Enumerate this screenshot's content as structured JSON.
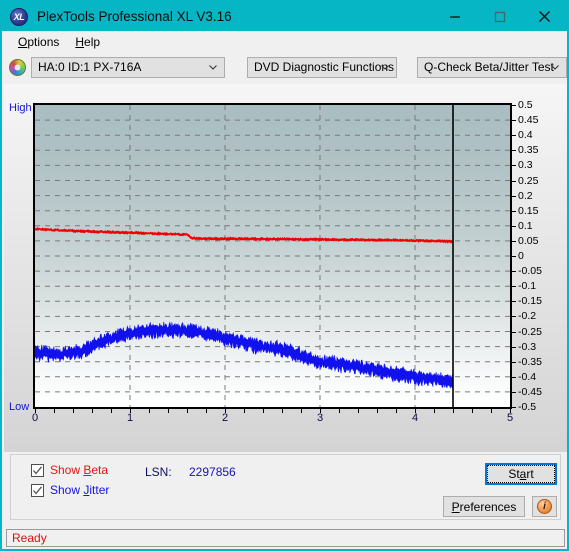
{
  "window": {
    "title": "PlexTools Professional XL V3.16",
    "icon": "xl-logo-icon",
    "minimize_label": "minimize-icon",
    "maximize_label": "maximize-icon",
    "close_label": "close-icon",
    "titlebar_color": "#06b6c4"
  },
  "menu": {
    "items": [
      {
        "label": "Options",
        "accel": "O"
      },
      {
        "label": "Help",
        "accel": "H"
      }
    ]
  },
  "toolbar": {
    "drive_icon": "optical-disc-icon",
    "drive_select": "HA:0 ID:1  PX-716A",
    "function_select": "DVD Diagnostic Functions",
    "test_select": "Q-Check Beta/Jitter Test"
  },
  "chart_labels": {
    "high": "High",
    "low": "Low"
  },
  "controls": {
    "show_beta": {
      "label_pre": "Show ",
      "accel": "B",
      "label_post": "eta",
      "checked": true,
      "color": "#e81414"
    },
    "show_jitter": {
      "label_pre": "Show ",
      "accel": "J",
      "label_post": "itter",
      "checked": true,
      "color": "#1414e8"
    },
    "lsn_label": "LSN:",
    "lsn_value": "2297856",
    "start_pre": "St",
    "start_accel": "a",
    "start_post": "rt",
    "preferences_accel": "P",
    "preferences_post": "references",
    "info_glyph": "i",
    "info_name": "info-icon"
  },
  "status": {
    "text": "Ready",
    "color": "#e01010"
  },
  "chart_data": {
    "type": "line",
    "title": "Q-Check Beta/Jitter Test",
    "xlabel": "",
    "ylabel": "",
    "xlim": [
      0,
      5
    ],
    "ylim": [
      -0.5,
      0.5
    ],
    "grid": true,
    "legend_position": "bottom-left",
    "x_ticks": [
      0,
      1,
      2,
      3,
      4,
      5
    ],
    "x_minor_tick_step": 0.2,
    "y_ticks": [
      0.5,
      0.45,
      0.4,
      0.35,
      0.3,
      0.25,
      0.2,
      0.15,
      0.1,
      0.05,
      0,
      -0.05,
      -0.1,
      -0.15,
      -0.2,
      -0.25,
      -0.3,
      -0.35,
      -0.4,
      -0.45,
      -0.5
    ],
    "data_end_x": 4.4,
    "marker_line_x": 4.4,
    "series": [
      {
        "name": "Beta",
        "color": "#ee0000",
        "x": [
          0.0,
          0.1,
          0.2,
          0.3,
          0.4,
          0.5,
          0.6,
          0.7,
          0.8,
          0.9,
          1.0,
          1.1,
          1.2,
          1.3,
          1.4,
          1.5,
          1.6,
          1.65,
          1.7,
          1.8,
          1.9,
          2.0,
          2.2,
          2.4,
          2.6,
          2.8,
          3.0,
          3.2,
          3.4,
          3.6,
          3.8,
          4.0,
          4.2,
          4.4
        ],
        "values": [
          0.09,
          0.088,
          0.086,
          0.085,
          0.083,
          0.082,
          0.081,
          0.08,
          0.079,
          0.078,
          0.077,
          0.076,
          0.075,
          0.074,
          0.073,
          0.072,
          0.071,
          0.06,
          0.058,
          0.057,
          0.057,
          0.057,
          0.057,
          0.056,
          0.056,
          0.055,
          0.055,
          0.054,
          0.054,
          0.053,
          0.052,
          0.051,
          0.05,
          0.048
        ],
        "noise": 0.006
      },
      {
        "name": "Jitter",
        "color": "#1111ee",
        "x": [
          0.0,
          0.1,
          0.2,
          0.3,
          0.4,
          0.5,
          0.6,
          0.7,
          0.8,
          0.9,
          1.0,
          1.1,
          1.2,
          1.3,
          1.4,
          1.5,
          1.6,
          1.7,
          1.8,
          1.9,
          2.0,
          2.1,
          2.2,
          2.3,
          2.4,
          2.5,
          2.6,
          2.7,
          2.8,
          2.9,
          3.0,
          3.1,
          3.2,
          3.3,
          3.4,
          3.5,
          3.6,
          3.7,
          3.8,
          3.9,
          4.0,
          4.1,
          4.2,
          4.3,
          4.4
        ],
        "values": [
          -0.32,
          -0.322,
          -0.325,
          -0.322,
          -0.32,
          -0.316,
          -0.3,
          -0.285,
          -0.272,
          -0.265,
          -0.258,
          -0.252,
          -0.248,
          -0.246,
          -0.245,
          -0.246,
          -0.248,
          -0.25,
          -0.256,
          -0.264,
          -0.272,
          -0.28,
          -0.288,
          -0.295,
          -0.3,
          -0.305,
          -0.312,
          -0.318,
          -0.33,
          -0.342,
          -0.35,
          -0.355,
          -0.358,
          -0.362,
          -0.366,
          -0.372,
          -0.378,
          -0.384,
          -0.39,
          -0.396,
          -0.4,
          -0.404,
          -0.408,
          -0.41,
          -0.412
        ],
        "noise": 0.03
      }
    ]
  }
}
